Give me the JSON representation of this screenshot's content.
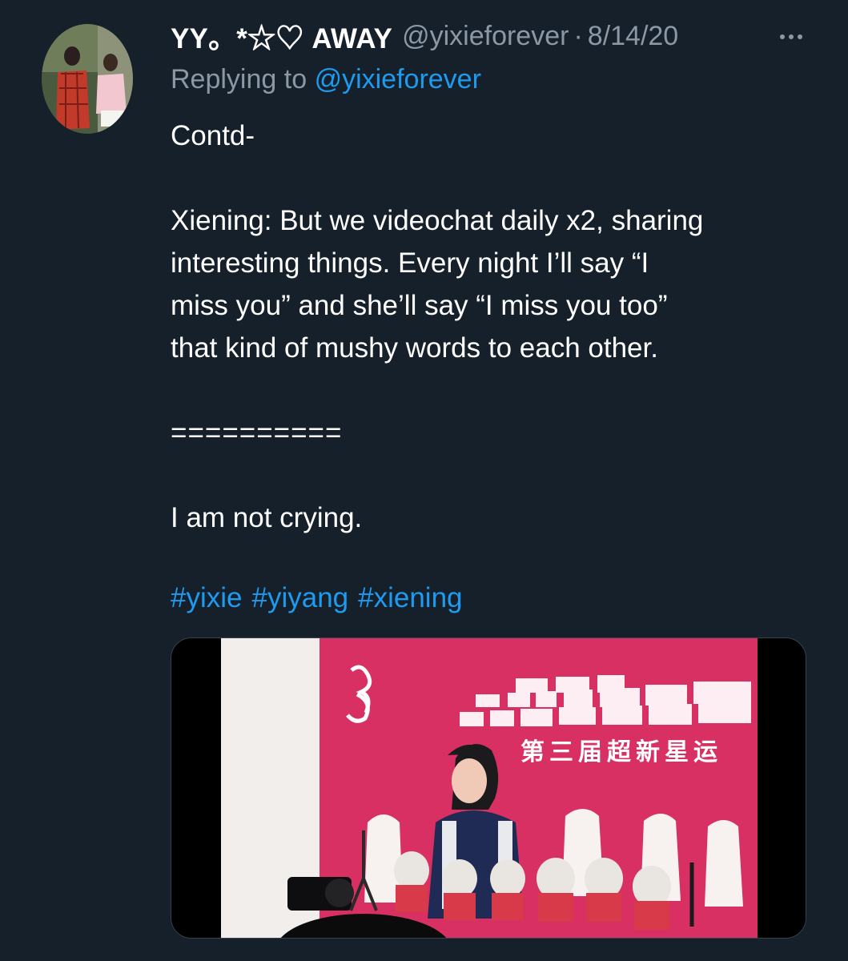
{
  "tweet": {
    "display_name": "YY。*☆♡ AWAY",
    "handle": "@yixieforever",
    "separator": "·",
    "date": "8/14/20",
    "replying_prefix": "Replying to",
    "replying_to": "@yixieforever",
    "body_lines": [
      "Contd-",
      "Xiening: But we videochat daily x2, sharing",
      "interesting things. Every night I’ll say “I",
      "miss you” and she’ll say “I miss you too”",
      "that kind of mushy words to each other.",
      "==========",
      "I am not crying."
    ],
    "hashtags": [
      "#yixie",
      "#yiyang",
      "#xiening"
    ]
  },
  "media": {
    "banner_text": "第三届超新星运",
    "type": "video-thumbnail"
  },
  "colors": {
    "background": "#15202b",
    "text": "#ffffff",
    "secondary": "#8b98a5",
    "link": "#1d9bf0",
    "banner": "#d93063"
  },
  "icons": [
    "more-options-icon"
  ]
}
